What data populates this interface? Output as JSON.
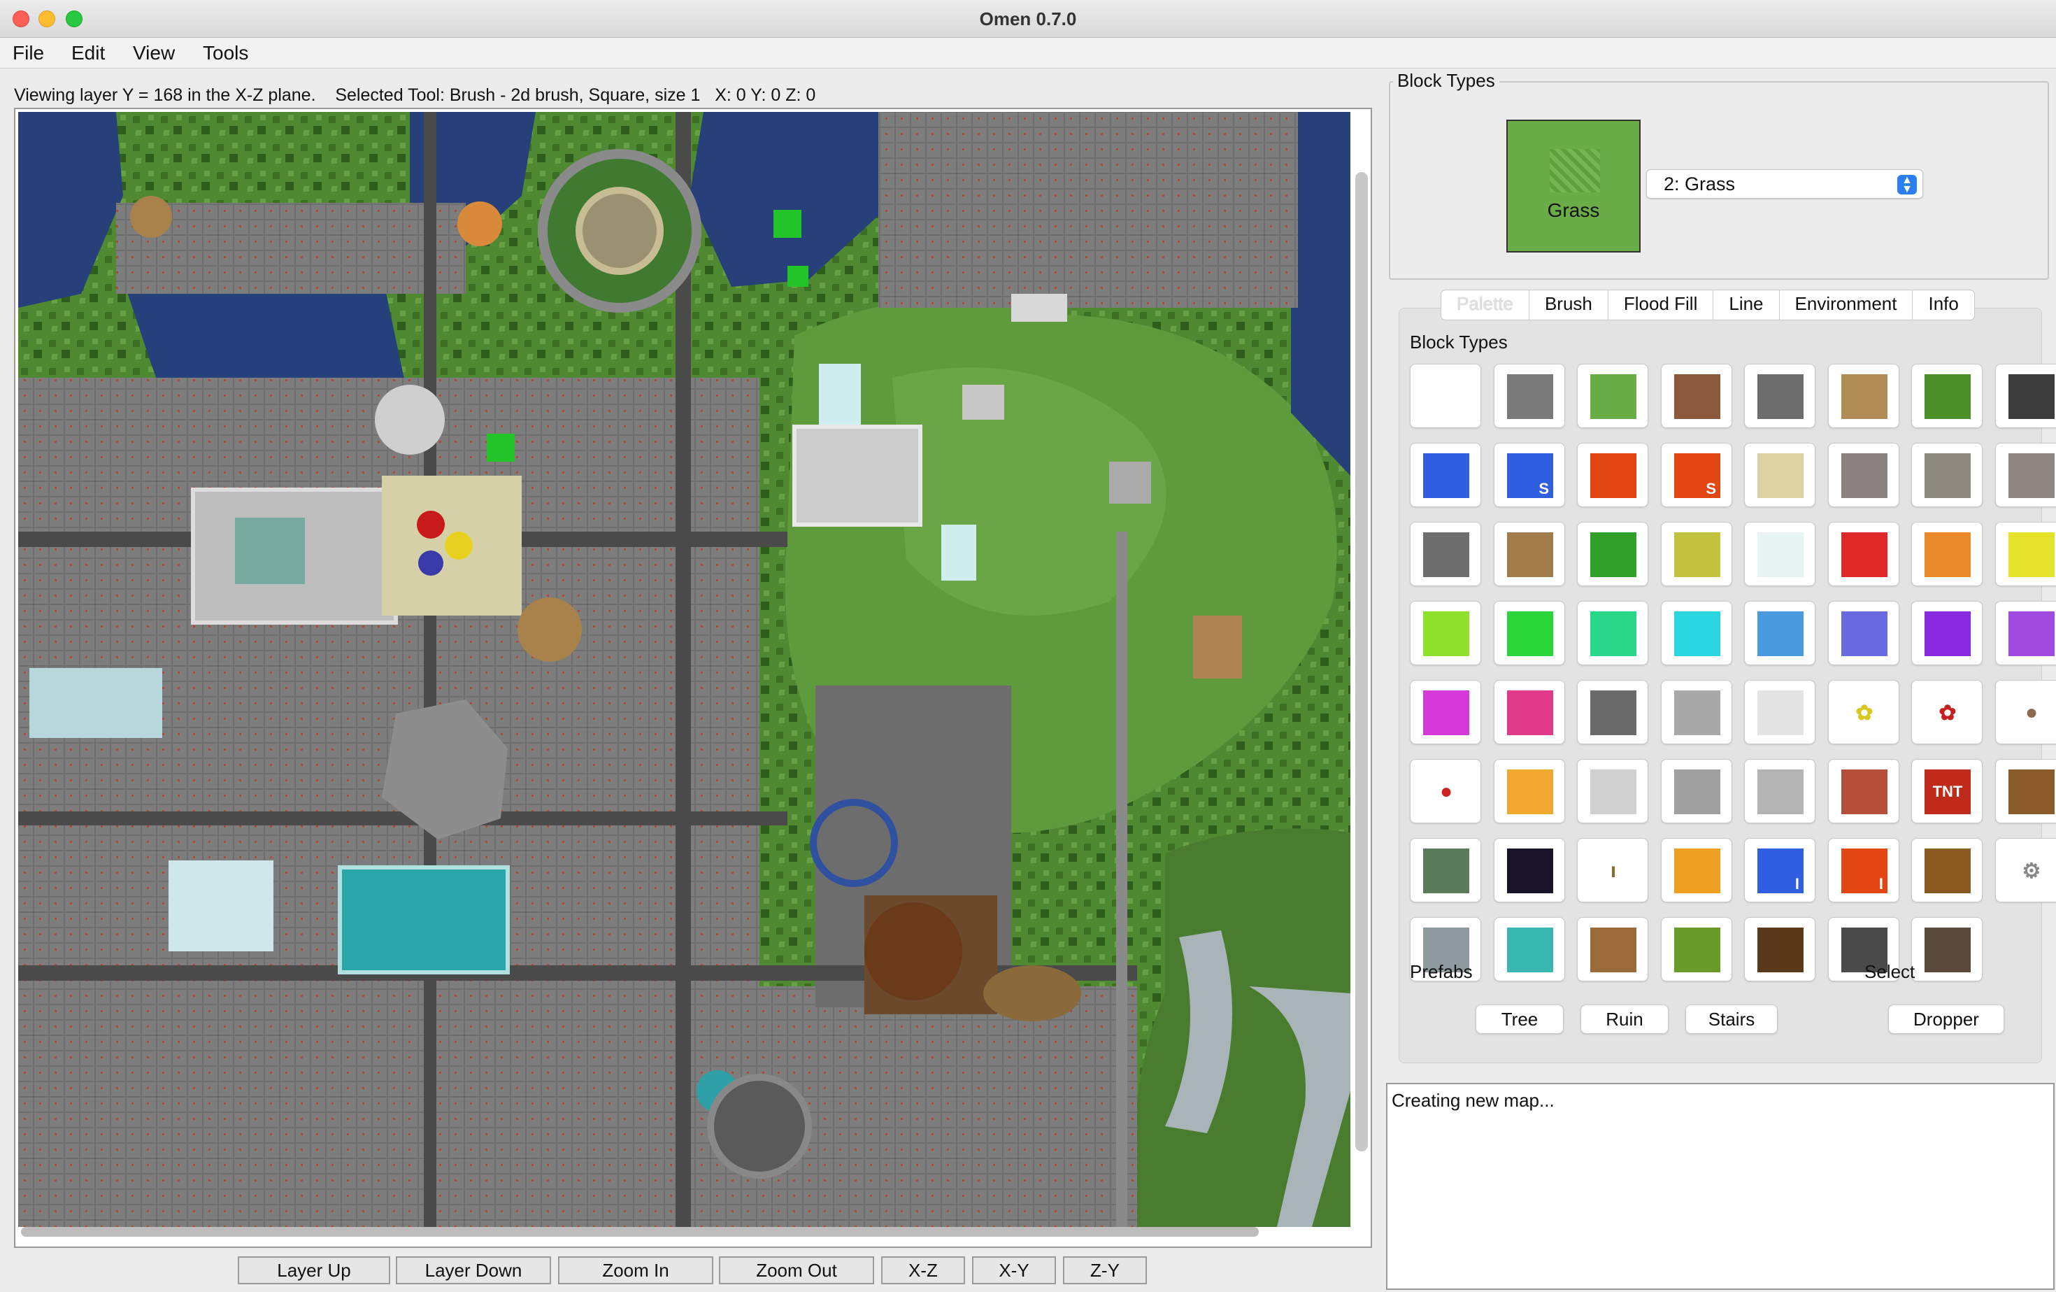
{
  "window": {
    "title": "Omen 0.7.0"
  },
  "menu": [
    "File",
    "Edit",
    "View",
    "Tools"
  ],
  "status": "Viewing layer Y = 168 in the X-Z plane.    Selected Tool: Brush - 2d brush, Square, size 1   X: 0 Y: 0 Z: 0",
  "block_types_panel": {
    "title": "Block Types",
    "selected_block_label": "Grass",
    "selected_option": "2: Grass"
  },
  "tabs": [
    "Palette",
    "Brush",
    "Flood Fill",
    "Line",
    "Environment",
    "Info"
  ],
  "palette": {
    "block_types_label": "Block Types",
    "prefabs_label": "Prefabs",
    "select_label": "Select",
    "prefab_buttons": [
      "Tree",
      "Ruin",
      "Stairs"
    ],
    "select_buttons": [
      "Dropper"
    ],
    "blocks": [
      {
        "icon": "air-block",
        "color": "#ffffff"
      },
      {
        "icon": "stone-block",
        "color": "#7a7a7a"
      },
      {
        "icon": "grass-block",
        "color": "#6aad48"
      },
      {
        "icon": "dirt-block",
        "color": "#8b5a3c"
      },
      {
        "icon": "cobblestone-block",
        "color": "#6d6d6d"
      },
      {
        "icon": "planks-block",
        "color": "#b08d57"
      },
      {
        "icon": "sapling-block",
        "color": "#4c8f2a"
      },
      {
        "icon": "bedrock-block",
        "color": "#3c3c3c"
      },
      {
        "icon": "water-block",
        "color": "#2f5fe0"
      },
      {
        "icon": "stationary-water-block",
        "color": "#2f5fe0",
        "mark": "S"
      },
      {
        "icon": "lava-block",
        "color": "#e24612"
      },
      {
        "icon": "stationary-lava-block",
        "color": "#e24612",
        "mark": "S"
      },
      {
        "icon": "sand-block",
        "color": "#ddd3a2"
      },
      {
        "icon": "gravel-block",
        "color": "#8a8280"
      },
      {
        "icon": "gold-ore-block",
        "color": "#8e8a80"
      },
      {
        "icon": "iron-ore-block",
        "color": "#8d8683"
      },
      {
        "icon": "coal-ore-block",
        "color": "#6e6e6e"
      },
      {
        "icon": "log-block",
        "color": "#a07c4a"
      },
      {
        "icon": "leaves-block",
        "color": "#2fa02a"
      },
      {
        "icon": "sponge-block",
        "color": "#c3c23f"
      },
      {
        "icon": "glass-block",
        "color": "#e8f4f4"
      },
      {
        "icon": "red-cloth-block",
        "color": "#e02a2a"
      },
      {
        "icon": "orange-cloth-block",
        "color": "#ea8a2a"
      },
      {
        "icon": "yellow-cloth-block",
        "color": "#e4e22a"
      },
      {
        "icon": "lime-cloth-block",
        "color": "#8fe02a"
      },
      {
        "icon": "green-cloth-block",
        "color": "#2ad63a"
      },
      {
        "icon": "aqua-green-cloth-block",
        "color": "#2ad68a"
      },
      {
        "icon": "cyan-cloth-block",
        "color": "#2ad6e0"
      },
      {
        "icon": "blue-cloth-block",
        "color": "#4a9ae0"
      },
      {
        "icon": "purple-cloth-block",
        "color": "#6a6ae0"
      },
      {
        "icon": "indigo-cloth-block",
        "color": "#8a2ae0"
      },
      {
        "icon": "violet-cloth-block",
        "color": "#a04ae0"
      },
      {
        "icon": "magenta-cloth-block",
        "color": "#d63ad6"
      },
      {
        "icon": "pink-cloth-block",
        "color": "#e03a8a"
      },
      {
        "icon": "black-cloth-block",
        "color": "#6a6a6a"
      },
      {
        "icon": "gray-cloth-block",
        "color": "#a8a8a8"
      },
      {
        "icon": "white-cloth-block",
        "color": "#e4e4e4"
      },
      {
        "icon": "dandelion-icon",
        "color": "#ffffff",
        "mark": "✿",
        "mark_color": "#d8c820"
      },
      {
        "icon": "rose-icon",
        "color": "#ffffff",
        "mark": "✿",
        "mark_color": "#c82020"
      },
      {
        "icon": "brown-mushroom-icon",
        "color": "#ffffff",
        "mark": "●",
        "mark_color": "#8a6a50"
      },
      {
        "icon": "red-mushroom-icon",
        "color": "#ffffff",
        "mark": "●",
        "mark_color": "#d02020"
      },
      {
        "icon": "gold-block",
        "color": "#f0a830"
      },
      {
        "icon": "iron-block",
        "color": "#d0d0d0"
      },
      {
        "icon": "double-slab-block",
        "color": "#a0a0a0"
      },
      {
        "icon": "slab-block",
        "color": "#b4b4b4"
      },
      {
        "icon": "brick-block",
        "color": "#b4503a"
      },
      {
        "icon": "tnt-block",
        "color": "#c02a1a",
        "mark": "TNT",
        "mark_color": "#ffffff"
      },
      {
        "icon": "bookshelf-block",
        "color": "#8a5a2a"
      },
      {
        "icon": "mossy-cobblestone-block",
        "color": "#5a7a5a"
      },
      {
        "icon": "obsidian-block",
        "color": "#1a1428"
      },
      {
        "icon": "torch-icon",
        "color": "#ffffff",
        "mark": "ı",
        "mark_color": "#8a6a30"
      },
      {
        "icon": "fire-block",
        "color": "#f0a020"
      },
      {
        "icon": "infinite-water-block",
        "color": "#2f5fe0",
        "mark": "I",
        "mark_color": "#ffffff"
      },
      {
        "icon": "infinite-lava-block",
        "color": "#e24612",
        "mark": "I",
        "mark_color": "#ffffff"
      },
      {
        "icon": "chest-block",
        "color": "#8a5a20"
      },
      {
        "icon": "gear-icon",
        "color": "#ffffff",
        "mark": "⚙",
        "mark_color": "#888888"
      },
      {
        "icon": "diamond-ore-block",
        "color": "#8e9a9e"
      },
      {
        "icon": "diamond-block",
        "color": "#38b8b0"
      },
      {
        "icon": "workbench-block",
        "color": "#9a6a3a"
      },
      {
        "icon": "crops-block",
        "color": "#6a9a2a"
      },
      {
        "icon": "soil-block",
        "color": "#5a3a1a"
      },
      {
        "icon": "furnace-block",
        "color": "#4a4a4a"
      },
      {
        "icon": "lit-furnace-block",
        "color": "#5a4a3a"
      }
    ]
  },
  "log": "Creating new map...",
  "bottom_buttons": [
    "Layer Up",
    "Layer Down",
    "Zoom In",
    "Zoom Out",
    "X-Z",
    "X-Y",
    "Z-Y"
  ]
}
